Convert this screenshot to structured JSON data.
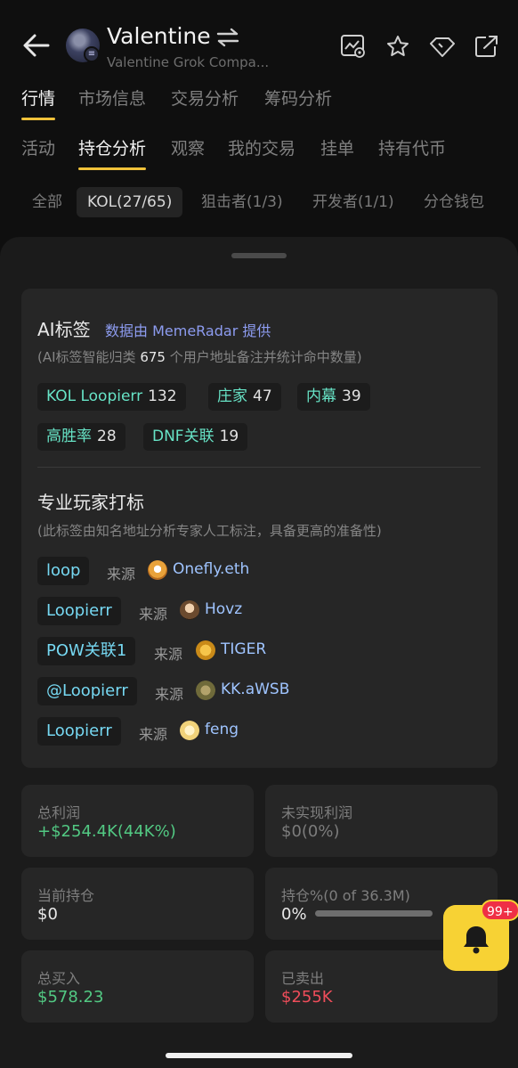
{
  "header": {
    "title": "Valentine",
    "subtitle": "Valentine Grok Compa...",
    "icons": [
      "back-arrow-icon",
      "swap-icon",
      "chart-watch-icon",
      "star-icon",
      "diamond-icon",
      "share-icon"
    ]
  },
  "main_tabs": [
    {
      "label": "行情"
    },
    {
      "label": "市场信息"
    },
    {
      "label": "交易分析"
    },
    {
      "label": "筹码分析"
    }
  ],
  "sub_tabs": [
    {
      "label": "活动"
    },
    {
      "label": "持仓分析"
    },
    {
      "label": "观察"
    },
    {
      "label": "我的交易"
    },
    {
      "label": "挂单"
    },
    {
      "label": "持有代币"
    }
  ],
  "filters": [
    {
      "label": "全部"
    },
    {
      "label": "KOL(27/65)"
    },
    {
      "label": "狙击者(1/3)"
    },
    {
      "label": "开发者(1/1)"
    },
    {
      "label": "分仓钱包"
    }
  ],
  "ai_labels": {
    "title": "AI标签",
    "provider": "数据由 MemeRadar 提供",
    "note_prefix": "(AI标签智能归类",
    "note_count": "675",
    "note_suffix": "个用户地址备注并统计命中数量)",
    "tags": [
      {
        "name": "KOL Loopierr",
        "count": "132"
      },
      {
        "name": "庄家",
        "count": "47"
      },
      {
        "name": "内幕",
        "count": "39"
      },
      {
        "name": "高胜率",
        "count": "28"
      },
      {
        "name": "DNF关联",
        "count": "19"
      }
    ]
  },
  "pro_labels": {
    "title": "专业玩家打标",
    "note": "(此标签由知名地址分析专家人工标注，具备更高的准备性)",
    "source_label": "来源",
    "rows": [
      {
        "tag": "loop",
        "source": "Onefly.eth"
      },
      {
        "tag": "Loopierr",
        "source": "Hovz"
      },
      {
        "tag": "POW关联1",
        "source": "TIGER"
      },
      {
        "tag": "@Loopierr",
        "source": "KK.aWSB"
      },
      {
        "tag": "Loopierr",
        "source": "feng"
      }
    ]
  },
  "stats": {
    "total_profit": {
      "label": "总利润",
      "value": "+$254.4K(44K%)"
    },
    "unrealized": {
      "label": "未实现利润",
      "value": "$0(0%)"
    },
    "holding": {
      "label": "当前持仓",
      "value": "$0"
    },
    "holding_pct": {
      "label": "持仓%(0 of 36.3M)",
      "value": "0%",
      "fill": 0
    },
    "bought": {
      "label": "总买入",
      "value": "$578.23"
    },
    "sold": {
      "label": "已卖出",
      "value": "$255K"
    }
  },
  "notification": {
    "badge": "99+"
  },
  "colors": {
    "accent": "#f0c23a",
    "ai_tag": "#67e3c6",
    "pro_tag": "#76d8f2",
    "profit": "#52c983",
    "loss": "#ef4d5a"
  }
}
